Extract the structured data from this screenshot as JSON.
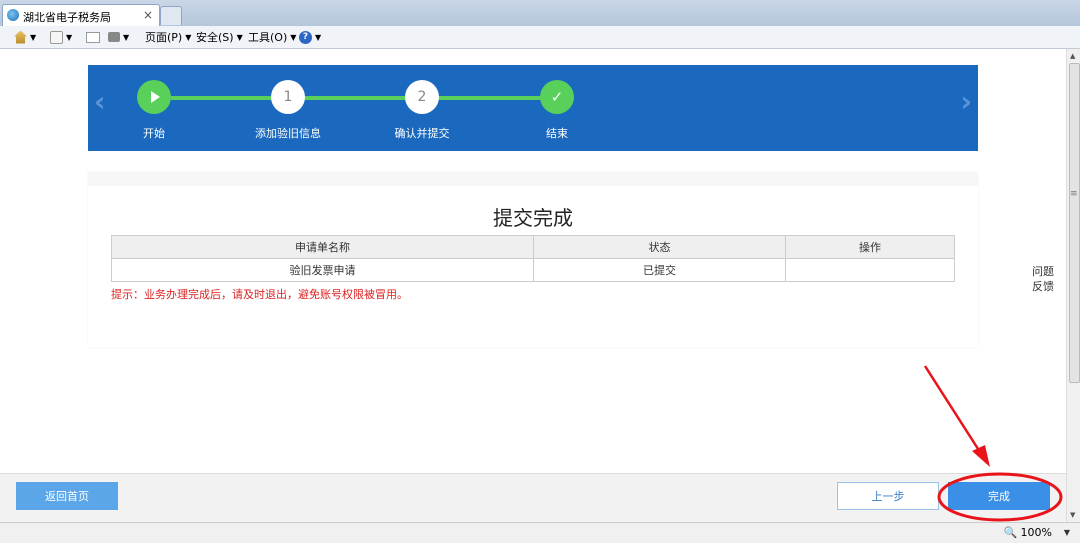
{
  "browser": {
    "tab_title": "湖北省电子税务局",
    "tab_close": "×",
    "toolbar": {
      "page_menu": "页面(P)",
      "safety_menu": "安全(S)",
      "tools_menu": "工具(O)"
    },
    "zoom": "100%"
  },
  "steps": [
    {
      "label": "开始",
      "marker": "",
      "state": "done"
    },
    {
      "label": "添加验旧信息",
      "marker": "1",
      "state": "pending"
    },
    {
      "label": "确认并提交",
      "marker": "2",
      "state": "pending"
    },
    {
      "label": "结束",
      "marker": "✓",
      "state": "current"
    }
  ],
  "nav_arrows": {
    "left": "‹",
    "right": "›"
  },
  "main": {
    "heading": "提交完成",
    "table": {
      "headers": [
        "申请单名称",
        "状态",
        "操作"
      ],
      "rows": [
        [
          "验旧发票申请",
          "已提交",
          ""
        ]
      ]
    },
    "hint": "提示：业务办理完成后，请及时退出，避免账号权限被冒用。"
  },
  "feedback": {
    "line1": "问题",
    "line2": "反馈"
  },
  "footer": {
    "home_button": "返回首页",
    "prev_button": "上一步",
    "done_button": "完成"
  },
  "colors": {
    "banner": "#1b69bf",
    "step_green": "#58d05a",
    "annotation_red": "#e8141a",
    "hint_red": "#d22222",
    "button_blue": "#3a8fe6"
  }
}
